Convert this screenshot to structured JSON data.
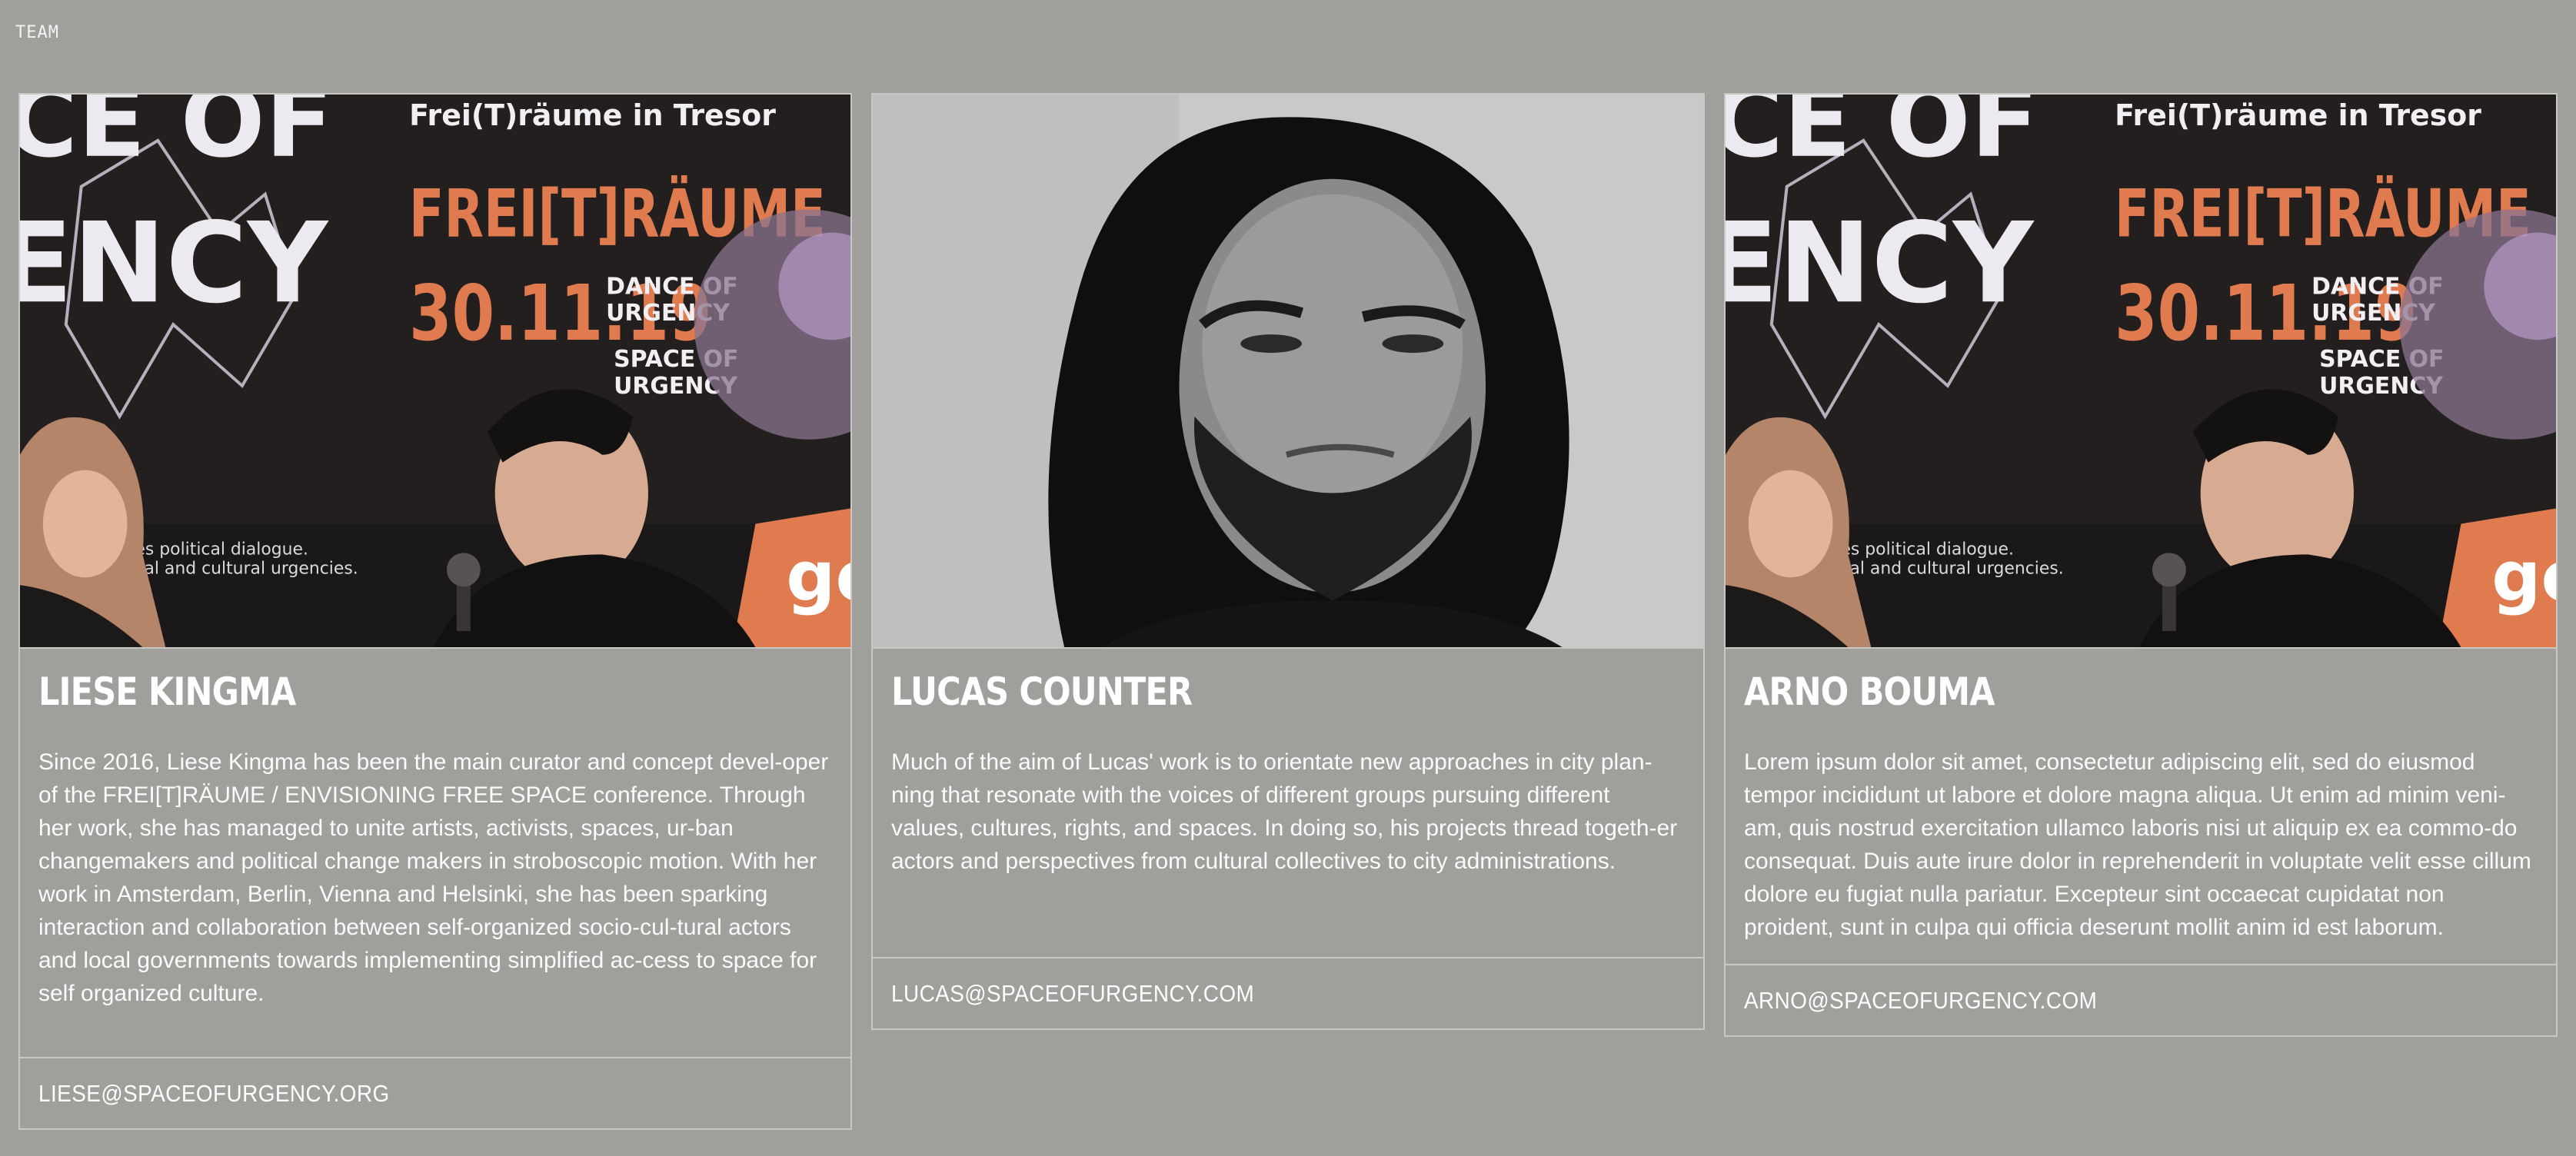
{
  "section": {
    "label": "TEAM"
  },
  "members": [
    {
      "name": "LIESE KINGMA",
      "bio": "Since 2016, Liese Kingma has been the main curator and concept devel-oper of the FREI[T]RÄUME / ENVISIONING FREE SPACE conference. Through her work, she has managed to unite artists, activists, spaces, ur-ban changemakers and political change makers in stroboscopic motion. With her work in Amsterdam, Berlin, Vienna and Helsinki, she has been sparking interaction and collaboration between self-organized socio-cul-tural actors and local governments towards implementing simplified ac-cess to space for self organized culture.",
      "email": "LIESE@SPACEOFURGENCY.ORG",
      "photo": "conference-panel-photo"
    },
    {
      "name": "LUCAS COUNTER",
      "bio": "Much of the aim of Lucas' work is to orientate new approaches in city plan-ning that resonate with the voices of different groups pursuing different values, cultures, rights, and spaces. In doing so, his projects thread togeth-er actors and perspectives from cultural collectives to city administrations.",
      "email": "LUCAS@SPACEOFURGENCY.COM",
      "photo": "portrait-photo"
    },
    {
      "name": "ARNO BOUMA",
      "bio": "Lorem ipsum dolor sit amet, consectetur adipiscing elit, sed do eiusmod tempor incididunt ut labore et dolore magna aliqua. Ut enim ad minim veni-am, quis nostrud exercitation ullamco laboris nisi ut aliquip ex ea commo-do consequat. Duis aute irure dolor in reprehenderit in voluptate velit esse cillum dolore eu fugiat nulla pariatur. Excepteur sint occaecat cupidatat non proident, sunt in culpa qui officia deserunt mollit anim id est laborum.",
      "email": "ARNO@SPACEOFURGENCY.COM",
      "photo": "conference-panel-photo"
    }
  ],
  "poster": {
    "line1": "CE OF",
    "line2": "ENCY",
    "headline": "FREI[T]RÄUME",
    "top": "Frei(T)räume in Tresor",
    "date": "30.11.19",
    "sub1": "DANCE OF",
    "sub2": "URGENCY",
    "sub3": "SPACE OF",
    "sub4": "URGENCY",
    "tagline1": "es political dialogue.",
    "tagline2": "cal and cultural urgencies.",
    "brand": "gew/"
  },
  "colors": {
    "background": "#a09f9c",
    "border": "#c7c7c4",
    "poster_orange": "#e07a4f"
  }
}
